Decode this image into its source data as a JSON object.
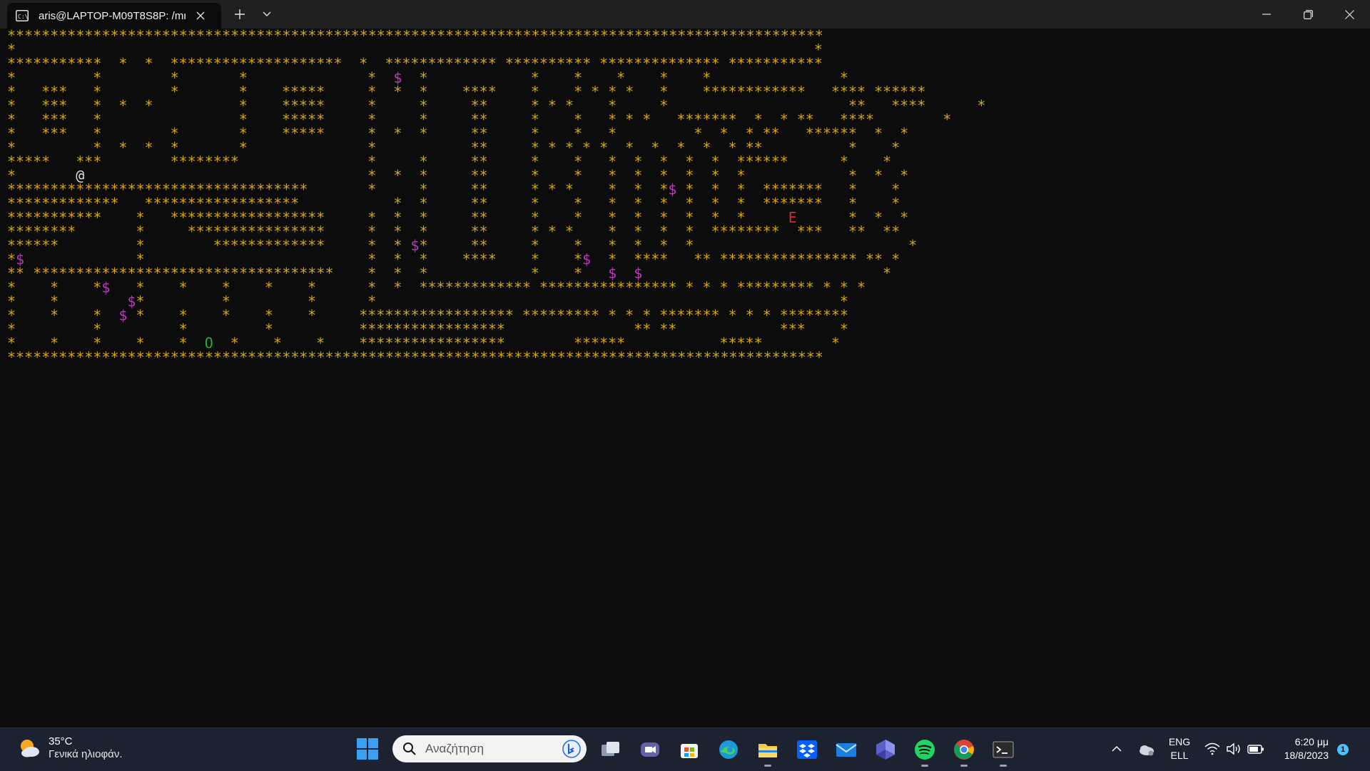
{
  "window": {
    "tab_title": "aris@LAPTOP-M09T8S8P: /mr",
    "tab_icon": "terminal-icon"
  },
  "terminal": {
    "colors": {
      "wall": "#d4a514",
      "gold": "#b83ab8",
      "player": "#dcdcdc",
      "exit": "#d12b2b",
      "start": "#22b12f",
      "background": "#0c0c0c"
    },
    "lines": [
      "***********************************************************************************************",
      "*                                                                                             *",
      "***********  *  *  ********************  *  ************* ********** ************** ***********",
      "*         *        *       *              *  $  *            *    *    *    *    *               *",
      "*   ***   *        *       *    *****     *  *  *    ****    *    * * * *   *    ************   **** ******",
      "*   ***   *  *  *          *    *****     *     *     **     * * *    *     *                     **   ****      *",
      "*   ***   *                *    *****     *     *     **     *    *   * * *   *******  *  * **   ****        *",
      "*   ***   *        *       *    *****     *  *  *     **     *    *   *         *  *  * **   ******  *  *",
      "*         *  *  *  *       *              *           **     * * * * *  *  *  *  *  * **          *    *",
      "*****   ***        ********               *     *     **     *    *   *  *  *  *  *  ******      *    *",
      "*       @                                 *  *  *     **     *    *   *  *  *  *  *  *            *  *  *",
      "***********************************       *     *     **     * * *    *  *  *$ *  *  *  *******   *    *",
      "*************   ******************           *  *     **     *    *   *  *  *  *  *  *  *******   *    *",
      "***********    *   ******************     *  *  *     **     *    *   *  *  *  *  *  *     E      *  *  *",
      "********       *     ****************     *  *  *     **     * * *    *  *  *  *  ********  ***   **  **",
      "******         *        *************     *  * $*     **     *    *   *  *  *  *                         *",
      "*$             *                          *  *  *    ****    *    *$  *  ****   ** **************** ** *",
      "** ***********************************    *  *  *            *    *   $  $                            *",
      "*    *    *$   *    *    *    *    *      *  *  ************* **************** * * * ********* * * *",
      "*    *        $*         *         *      *                                                      *",
      "*    *    *  $ *    *    *    *    *     ****************** ********* * * * ******* * * * ********",
      "*         *         *         *          *****************               ** **            ***    *",
      "*    *    *    *    *  O  *    *    *    *****************        ******           *****        *",
      "***********************************************************************************************"
    ]
  },
  "taskbar": {
    "weather": {
      "temp": "35°C",
      "desc": "Γενικά ηλιοφάν.",
      "icon": "sun-behind-cloud-icon"
    },
    "search_placeholder": "Αναζήτηση",
    "apps": [
      {
        "name": "task-view-icon",
        "running": false
      },
      {
        "name": "teams-chat-icon",
        "running": false
      },
      {
        "name": "microsoft-store-icon",
        "running": false
      },
      {
        "name": "edge-browser-icon",
        "running": false
      },
      {
        "name": "file-explorer-icon",
        "running": true
      },
      {
        "name": "dropbox-icon",
        "running": false
      },
      {
        "name": "mail-icon",
        "running": false
      },
      {
        "name": "app-hexagon-icon",
        "running": false
      },
      {
        "name": "spotify-icon",
        "running": true
      },
      {
        "name": "chrome-icon",
        "running": true
      },
      {
        "name": "terminal-app-icon",
        "running": true
      }
    ],
    "lang_top": "ENG",
    "lang_bottom": "ELL",
    "time": "6:20 μμ",
    "date": "18/8/2023",
    "notification_count": "1"
  }
}
